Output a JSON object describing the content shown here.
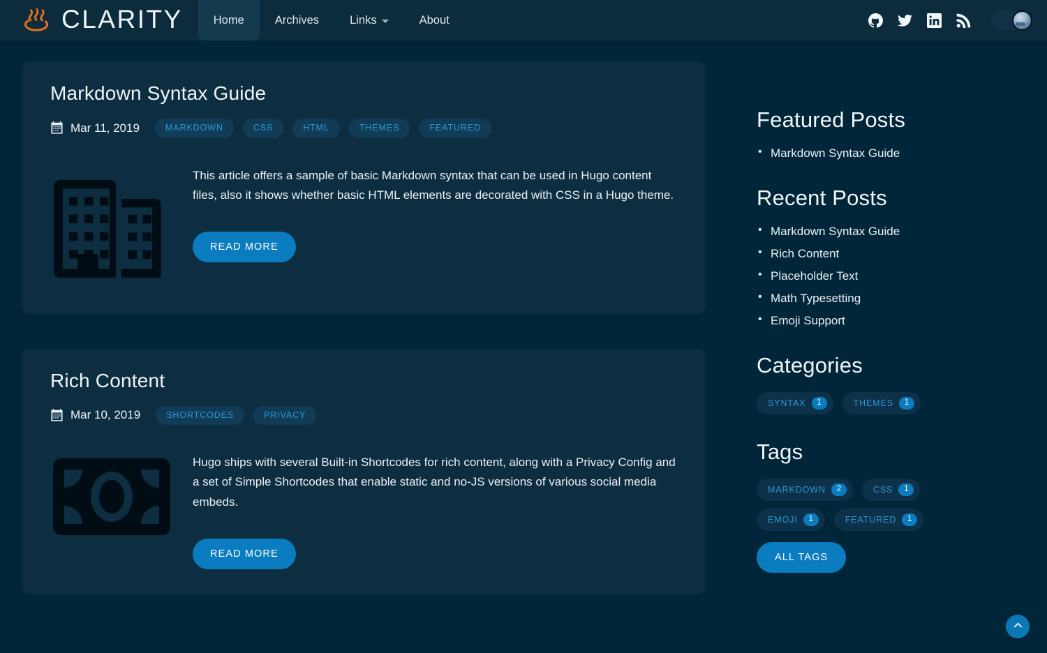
{
  "site": {
    "brand_name": "CLARITY",
    "logo_icon": "hot-spring-icon"
  },
  "nav": {
    "items": [
      {
        "label": "Home",
        "active": true,
        "has_caret": false
      },
      {
        "label": "Archives",
        "active": false,
        "has_caret": false
      },
      {
        "label": "Links",
        "active": false,
        "has_caret": true
      },
      {
        "label": "About",
        "active": false,
        "has_caret": false
      }
    ],
    "social": [
      {
        "name": "github-icon"
      },
      {
        "name": "twitter-icon"
      },
      {
        "name": "linkedin-icon"
      },
      {
        "name": "rss-icon"
      }
    ],
    "theme_toggle": {
      "name": "dark-mode-toggle",
      "state": "dark"
    }
  },
  "posts": [
    {
      "title": "Markdown Syntax Guide",
      "date": "Mar 11, 2019",
      "date_icon": "calendar-icon",
      "tags": [
        "MARKDOWN",
        "CSS",
        "HTML",
        "THEMES",
        "FEATURED"
      ],
      "thumbnail_icon": "buildings-icon",
      "excerpt": "This article offers a sample of basic Markdown syntax that can be used in Hugo content files, also it shows whether basic HTML elements are decorated with CSS in a Hugo theme.",
      "read_more_label": "READ MORE"
    },
    {
      "title": "Rich Content",
      "date": "Mar 10, 2019",
      "date_icon": "calendar-icon",
      "tags": [
        "SHORTCODES",
        "PRIVACY"
      ],
      "thumbnail_icon": "money-bill-icon",
      "excerpt": "Hugo ships with several Built-in Shortcodes for rich content, along with a Privacy Config and a set of Simple Shortcodes that enable static and no-JS versions of various social media embeds.",
      "read_more_label": "READ MORE"
    }
  ],
  "sidebar": {
    "featured": {
      "heading": "Featured Posts",
      "items": [
        "Markdown Syntax Guide"
      ]
    },
    "recent": {
      "heading": "Recent Posts",
      "items": [
        "Markdown Syntax Guide",
        "Rich Content",
        "Placeholder Text",
        "Math Typesetting",
        "Emoji Support"
      ]
    },
    "categories": {
      "heading": "Categories",
      "items": [
        {
          "label": "SYNTAX",
          "count": "1"
        },
        {
          "label": "THEMES",
          "count": "1"
        }
      ]
    },
    "tags": {
      "heading": "Tags",
      "items": [
        {
          "label": "MARKDOWN",
          "count": "2"
        },
        {
          "label": "CSS",
          "count": "1"
        },
        {
          "label": "EMOJI",
          "count": "1"
        },
        {
          "label": "FEATURED",
          "count": "1"
        }
      ],
      "all_tags_label": "ALL TAGS"
    }
  },
  "scroll_top": {
    "name": "scroll-to-top-button",
    "icon": "chevron-up-icon"
  },
  "colors": {
    "page_bg": "#012639",
    "card_bg": "#0d2e40",
    "navbar_bg": "#0c2b3c",
    "accent": "#0a7cbf",
    "pill_bg": "#123c55",
    "pill_text": "#2b98da",
    "logo_orange": "#e0701e"
  }
}
